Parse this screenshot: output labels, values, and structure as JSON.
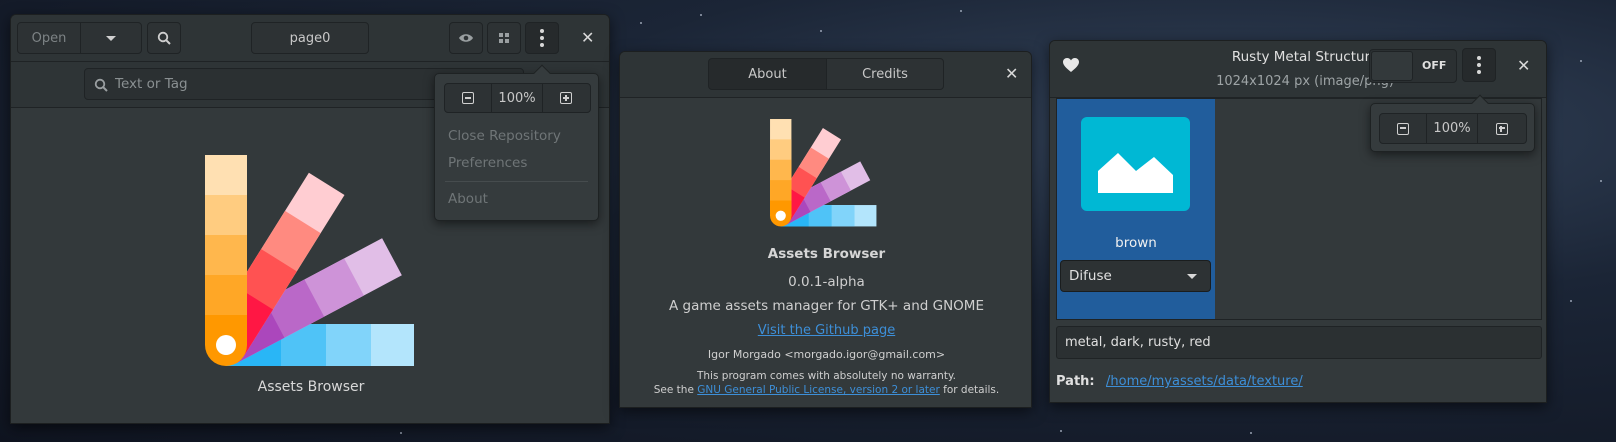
{
  "main_window": {
    "open_label": "Open",
    "page_label": "page0",
    "search_placeholder": "Text or Tag",
    "app_caption": "Assets Browser",
    "menu": {
      "zoom": "100%",
      "close_repository": "Close Repository",
      "preferences": "Preferences",
      "about": "About"
    }
  },
  "about_dialog": {
    "tabs": [
      "About",
      "Credits"
    ],
    "app_name": "Assets Browser",
    "version": "0.0.1-alpha",
    "description": "A game assets manager for GTK+ and GNOME",
    "website_link": "Visit the Github page",
    "author": "Igor Morgado <morgado.igor@gmail.com>",
    "license_line1": "This program comes with absolutely no warranty.",
    "license_pre": "See the",
    "license_link": "GNU General Public License, version 2 or later",
    "license_post": "for details."
  },
  "asset_window": {
    "title": "Rusty Metal Structure",
    "subtitle": "1024x1024 px (image/png)",
    "toggle_label": "OFF",
    "zoom": "100%",
    "texture_name": "brown",
    "texture_type": "Difuse",
    "tags": "metal, dark, rusty, red",
    "path_label": "Path:",
    "path_value": "/home/myassets/data/texture/"
  },
  "colors": {
    "window_bg": "#33393b",
    "accent_blue": "#215d9c",
    "link": "#3d8fd8",
    "thumbnail": "#00b8d4"
  }
}
